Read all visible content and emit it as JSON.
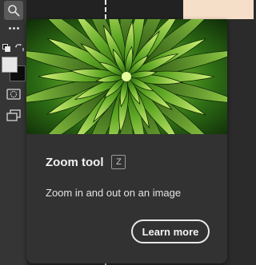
{
  "toolbar": {
    "tools": [
      {
        "icon": "zoom-icon",
        "active": true
      },
      {
        "icon": "more-tools-icon"
      },
      {
        "icon": "default-colors-icon"
      },
      {
        "icon": "swap-colors-icon"
      },
      {
        "icon": "quick-mask-icon"
      },
      {
        "icon": "screen-mode-icon"
      }
    ],
    "foreground_color": "#e6e6e6",
    "background_color": "#0d0d0d"
  },
  "tooltip": {
    "title": "Zoom tool",
    "shortcut": "Z",
    "description": "Zoom in and out on an image",
    "learn_more_label": "Learn more",
    "image": "succulent-rosette-photo"
  },
  "colors": {
    "toolbar_bg": "#353535",
    "tooltip_bg": "#323232",
    "accent_green": "#7ec23a"
  }
}
